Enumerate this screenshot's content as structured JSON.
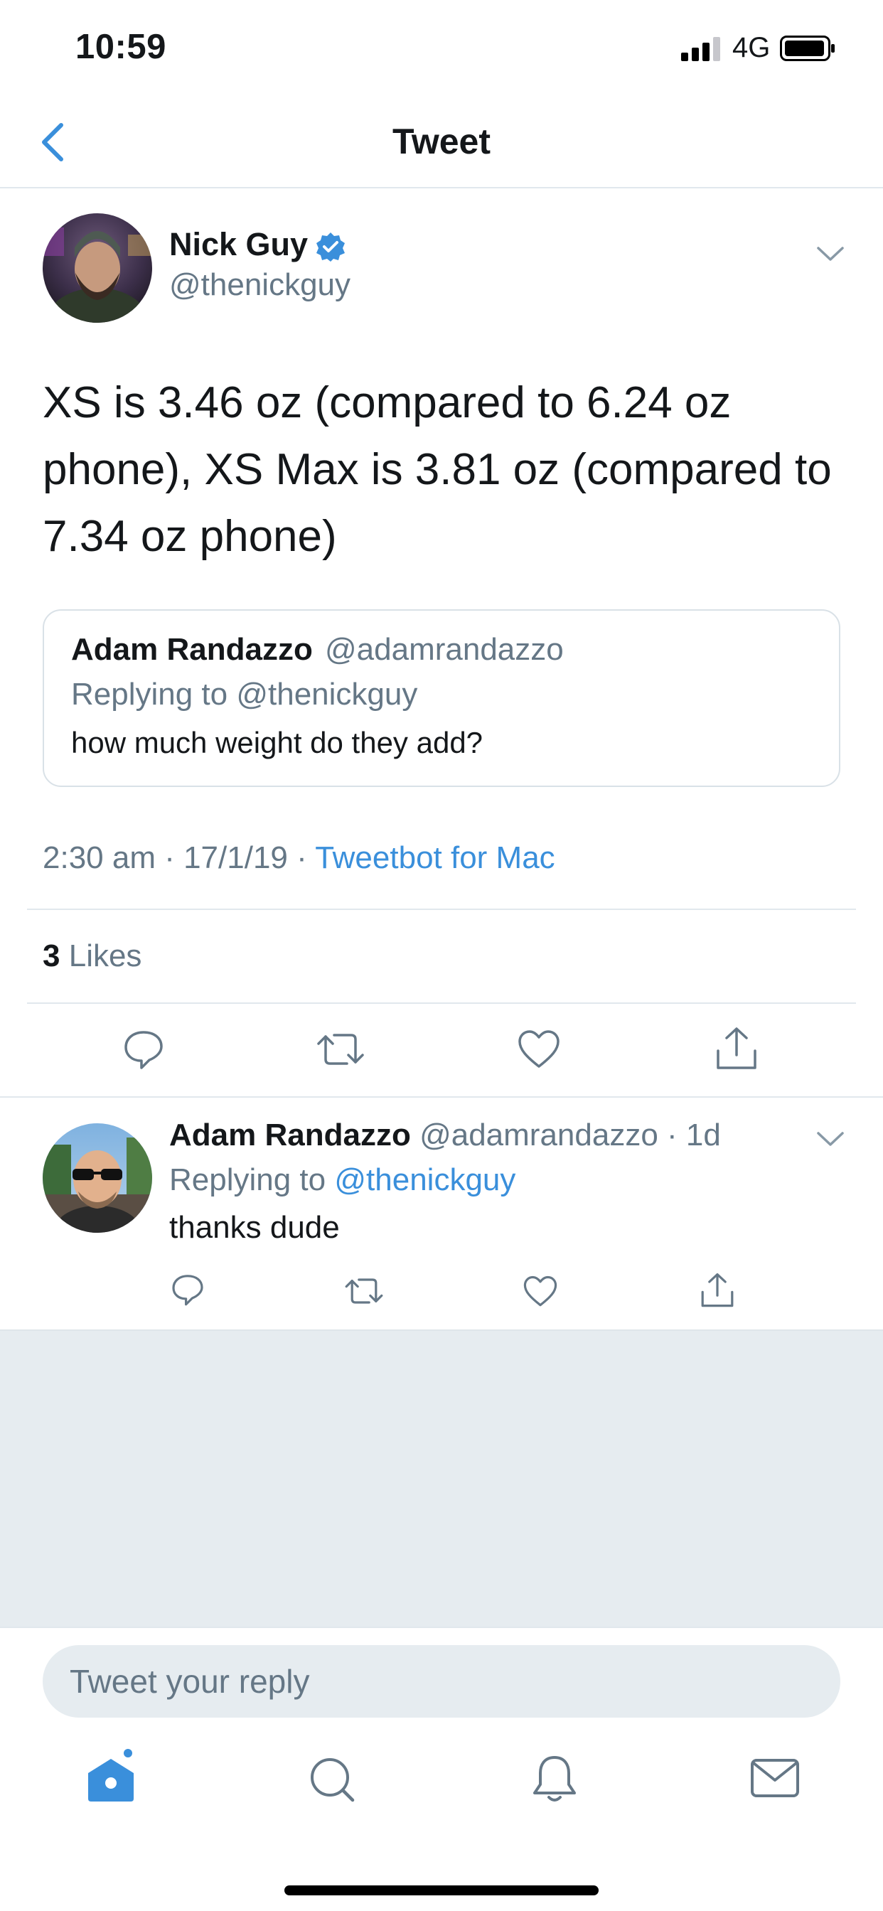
{
  "status_bar": {
    "time": "10:59",
    "network": "4G",
    "icons": [
      "signal-icon",
      "battery-icon"
    ]
  },
  "nav": {
    "title": "Tweet",
    "back_icon": "chevron-left-icon"
  },
  "tweet": {
    "author_name": "Nick Guy",
    "author_handle": "@thenickguy",
    "verified": true,
    "text": "XS is 3.46 oz (compared to 6.24 oz phone), XS Max is 3.81 oz (compared to 7.34 oz phone)",
    "quote": {
      "name": "Adam Randazzo",
      "handle": "@adamrandazzo",
      "replying_to": "Replying to @thenickguy",
      "text": "how much weight do they add?"
    },
    "timestamp": "2:30 am · 17/1/19 · ",
    "source": "Tweetbot for Mac",
    "likes_count": "3",
    "likes_label": "Likes",
    "actions": [
      "reply-icon",
      "retweet-icon",
      "like-icon",
      "share-icon"
    ]
  },
  "reply": {
    "name": "Adam Randazzo",
    "handle_time": "@adamrandazzo · 1d",
    "replying_prefix": "Replying to ",
    "replying_mention": "@thenickguy",
    "text": "thanks dude",
    "actions": [
      "reply-icon",
      "retweet-icon",
      "like-icon",
      "share-icon"
    ]
  },
  "composer": {
    "placeholder": "Tweet your reply"
  },
  "tabbar": {
    "tabs": [
      "home-icon",
      "search-icon",
      "notifications-icon",
      "messages-icon"
    ],
    "active": "home-icon"
  },
  "colors": {
    "accent": "#3a8fdb",
    "secondary_text": "#657786",
    "background_gray": "#e6ecf0"
  }
}
